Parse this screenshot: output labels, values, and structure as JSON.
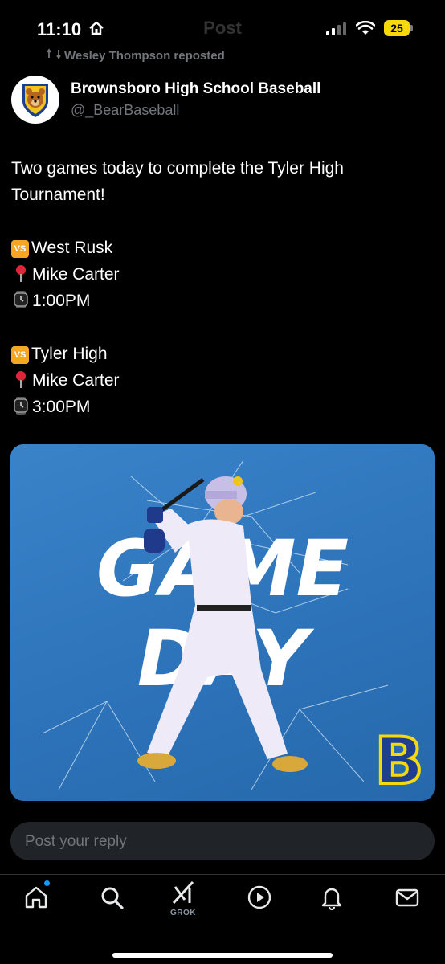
{
  "status_bar": {
    "time": "11:10",
    "battery": "25",
    "faded_title": "Post"
  },
  "repost": {
    "text": "Wesley Thompson reposted"
  },
  "post": {
    "author_name": "Brownsboro High School Baseball",
    "author_handle": "@_BearBaseball",
    "lines": [
      "Two games today to complete the Tyler High",
      "Tournament!",
      "West Rusk",
      "Mike Carter",
      "1:00PM",
      "Tyler High",
      "Mike Carter",
      "3:00PM"
    ],
    "vs_emoji": "VS"
  },
  "media": {
    "headline_1": "GAME",
    "headline_2": "DAY",
    "logo_letter": "B"
  },
  "reply": {
    "placeholder": "Post your reply"
  },
  "tab_bar": {
    "grok_label": "GROK"
  },
  "colors": {
    "accent": "#1d9bf0",
    "media_bg": "#2f76bd",
    "battery": "#f5d90a"
  }
}
